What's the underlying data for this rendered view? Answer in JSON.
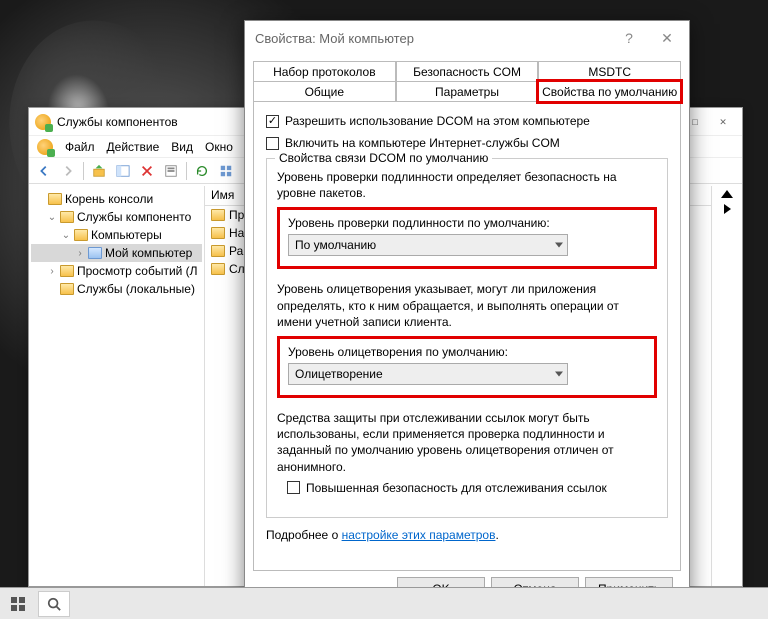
{
  "mmc": {
    "title": "Службы компонентов",
    "menu": {
      "file": "Файл",
      "action": "Действие",
      "view": "Вид",
      "window": "Окно"
    },
    "tree": {
      "root": "Корень консоли",
      "services": "Службы компоненто",
      "computers": "Компьютеры",
      "mycomputer": "Мой компьютер",
      "eventviewer": "Просмотр событий (Л",
      "localservices": "Службы (локальные)"
    },
    "list": {
      "header": "Имя",
      "rows": {
        "r0": "Пр",
        "r1": "На",
        "r2": "Ра(",
        "r3": "Сл"
      }
    }
  },
  "dlg": {
    "title": "Свойства: Мой компьютер",
    "help_glyph": "?",
    "close_glyph": "✕",
    "tabs": {
      "protocols": "Набор протоколов",
      "comsec": "Безопасность COM",
      "msdtc": "MSDTC",
      "general": "Общие",
      "params": "Параметры",
      "defprops": "Свойства по умолчанию"
    },
    "checks": {
      "allowdcom": "Разрешить использование DCOM на этом компьютере",
      "enableiis": "Включить на компьютере Интернет-службы COM"
    },
    "fieldset_title": "Свойства связи DCOM по умолчанию",
    "auth_desc": "Уровень проверки подлинности определяет безопасность на уровне пакетов.",
    "auth_label": "Уровень проверки подлинности по умолчанию:",
    "auth_value": "По умолчанию",
    "imp_desc": "Уровень олицетворения указывает, могут ли приложения определять, кто к ним обращается, и выполнять операции от имени учетной записи клиента.",
    "imp_label": "Уровень олицетворения по умолчанию:",
    "imp_value": "Олицетворение",
    "track_desc": "Средства защиты при отслеживании ссылок могут быть использованы, если применяется проверка подлинности и заданный по умолчанию уровень олицетворения отличен от анонимного.",
    "track_check": "Повышенная безопасность для отслеживания ссылок",
    "more_prefix": "Подробнее о ",
    "more_link": "настройке этих параметров",
    "buttons": {
      "ok": "OK",
      "cancel": "Отмена",
      "apply": "Применить"
    }
  }
}
